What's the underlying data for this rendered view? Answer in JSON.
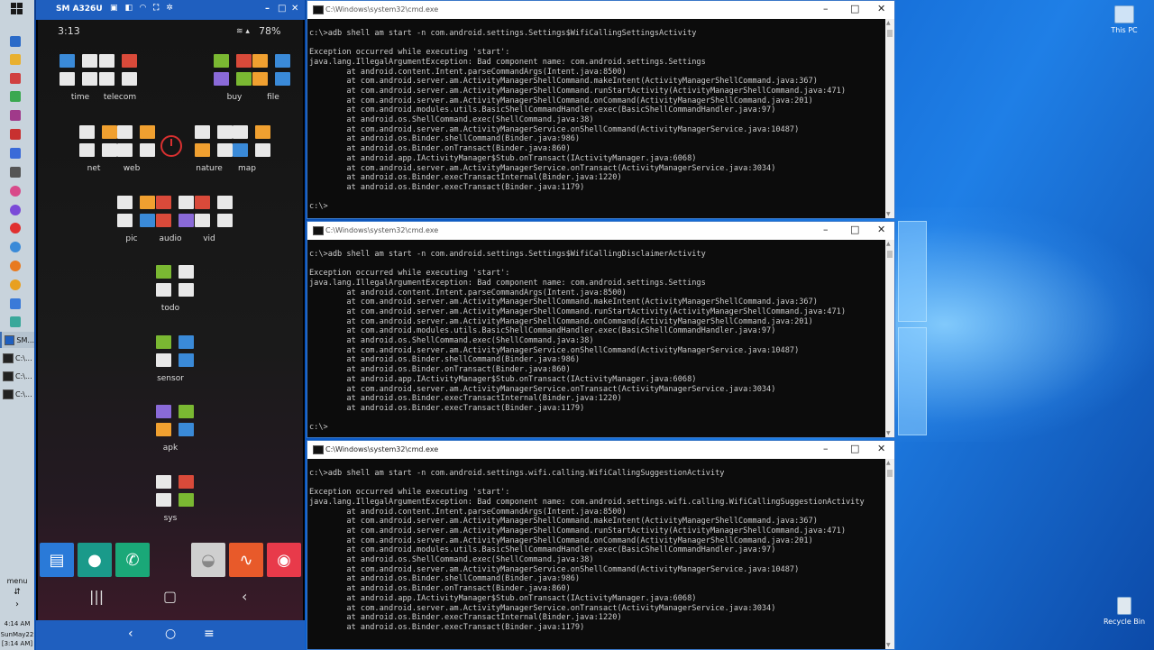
{
  "desktop": {
    "icons": [
      {
        "label": "This PC"
      },
      {
        "label": "Recycle Bin"
      }
    ]
  },
  "taskbar": {
    "tasks": [
      {
        "label": "SM..."
      },
      {
        "label": "C:\\..."
      },
      {
        "label": "C:\\..."
      },
      {
        "label": "C:\\..."
      }
    ],
    "menu_label": "menu",
    "time": "4:14 AM",
    "date": "SunMay22",
    "time2": "[3:14 AM]"
  },
  "phone": {
    "window_title": "SM A326U",
    "status_time": "3:13",
    "battery": "78%",
    "folders": [
      "time",
      "telecom",
      "buy",
      "file",
      "net",
      "web",
      "nature",
      "map",
      "pic",
      "audio",
      "vid",
      "todo",
      "sensor",
      "apk",
      "sys"
    ]
  },
  "cmd_windows": [
    {
      "title": "C:\\Windows\\system32\\cmd.exe",
      "text": "\nc:\\>adb shell am start -n com.android.settings.Settings$WifiCallingSettingsActivity\n\nException occurred while executing 'start':\njava.lang.IllegalArgumentException: Bad component name: com.android.settings.Settings\n        at android.content.Intent.parseCommandArgs(Intent.java:8500)\n        at com.android.server.am.ActivityManagerShellCommand.makeIntent(ActivityManagerShellCommand.java:367)\n        at com.android.server.am.ActivityManagerShellCommand.runStartActivity(ActivityManagerShellCommand.java:471)\n        at com.android.server.am.ActivityManagerShellCommand.onCommand(ActivityManagerShellCommand.java:201)\n        at com.android.modules.utils.BasicShellCommandHandler.exec(BasicShellCommandHandler.java:97)\n        at android.os.ShellCommand.exec(ShellCommand.java:38)\n        at com.android.server.am.ActivityManagerService.onShellCommand(ActivityManagerService.java:10487)\n        at android.os.Binder.shellCommand(Binder.java:986)\n        at android.os.Binder.onTransact(Binder.java:860)\n        at android.app.IActivityManager$Stub.onTransact(IActivityManager.java:6068)\n        at com.android.server.am.ActivityManagerService.onTransact(ActivityManagerService.java:3034)\n        at android.os.Binder.execTransactInternal(Binder.java:1220)\n        at android.os.Binder.execTransact(Binder.java:1179)\n\nc:\\>"
    },
    {
      "title": "C:\\Windows\\system32\\cmd.exe",
      "text": "\nc:\\>adb shell am start -n com.android.settings.Settings$WifiCallingDisclaimerActivity\n\nException occurred while executing 'start':\njava.lang.IllegalArgumentException: Bad component name: com.android.settings.Settings\n        at android.content.Intent.parseCommandArgs(Intent.java:8500)\n        at com.android.server.am.ActivityManagerShellCommand.makeIntent(ActivityManagerShellCommand.java:367)\n        at com.android.server.am.ActivityManagerShellCommand.runStartActivity(ActivityManagerShellCommand.java:471)\n        at com.android.server.am.ActivityManagerShellCommand.onCommand(ActivityManagerShellCommand.java:201)\n        at com.android.modules.utils.BasicShellCommandHandler.exec(BasicShellCommandHandler.java:97)\n        at android.os.ShellCommand.exec(ShellCommand.java:38)\n        at com.android.server.am.ActivityManagerService.onShellCommand(ActivityManagerService.java:10487)\n        at android.os.Binder.shellCommand(Binder.java:986)\n        at android.os.Binder.onTransact(Binder.java:860)\n        at android.app.IActivityManager$Stub.onTransact(IActivityManager.java:6068)\n        at com.android.server.am.ActivityManagerService.onTransact(ActivityManagerService.java:3034)\n        at android.os.Binder.execTransactInternal(Binder.java:1220)\n        at android.os.Binder.execTransact(Binder.java:1179)\n\nc:\\>"
    },
    {
      "title": "C:\\Windows\\system32\\cmd.exe",
      "text": "\nc:\\>adb shell am start -n com.android.settings.wifi.calling.WifiCallingSuggestionActivity\n\nException occurred while executing 'start':\njava.lang.IllegalArgumentException: Bad component name: com.android.settings.wifi.calling.WifiCallingSuggestionActivity\n        at android.content.Intent.parseCommandArgs(Intent.java:8500)\n        at com.android.server.am.ActivityManagerShellCommand.makeIntent(ActivityManagerShellCommand.java:367)\n        at com.android.server.am.ActivityManagerShellCommand.runStartActivity(ActivityManagerShellCommand.java:471)\n        at com.android.server.am.ActivityManagerShellCommand.onCommand(ActivityManagerShellCommand.java:201)\n        at com.android.modules.utils.BasicShellCommandHandler.exec(BasicShellCommandHandler.java:97)\n        at android.os.ShellCommand.exec(ShellCommand.java:38)\n        at com.android.server.am.ActivityManagerService.onShellCommand(ActivityManagerService.java:10487)\n        at android.os.Binder.shellCommand(Binder.java:986)\n        at android.os.Binder.onTransact(Binder.java:860)\n        at android.app.IActivityManager$Stub.onTransact(IActivityManager.java:6068)\n        at com.android.server.am.ActivityManagerService.onTransact(ActivityManagerService.java:3034)\n        at android.os.Binder.execTransactInternal(Binder.java:1220)\n        at android.os.Binder.execTransact(Binder.java:1179)"
    }
  ]
}
